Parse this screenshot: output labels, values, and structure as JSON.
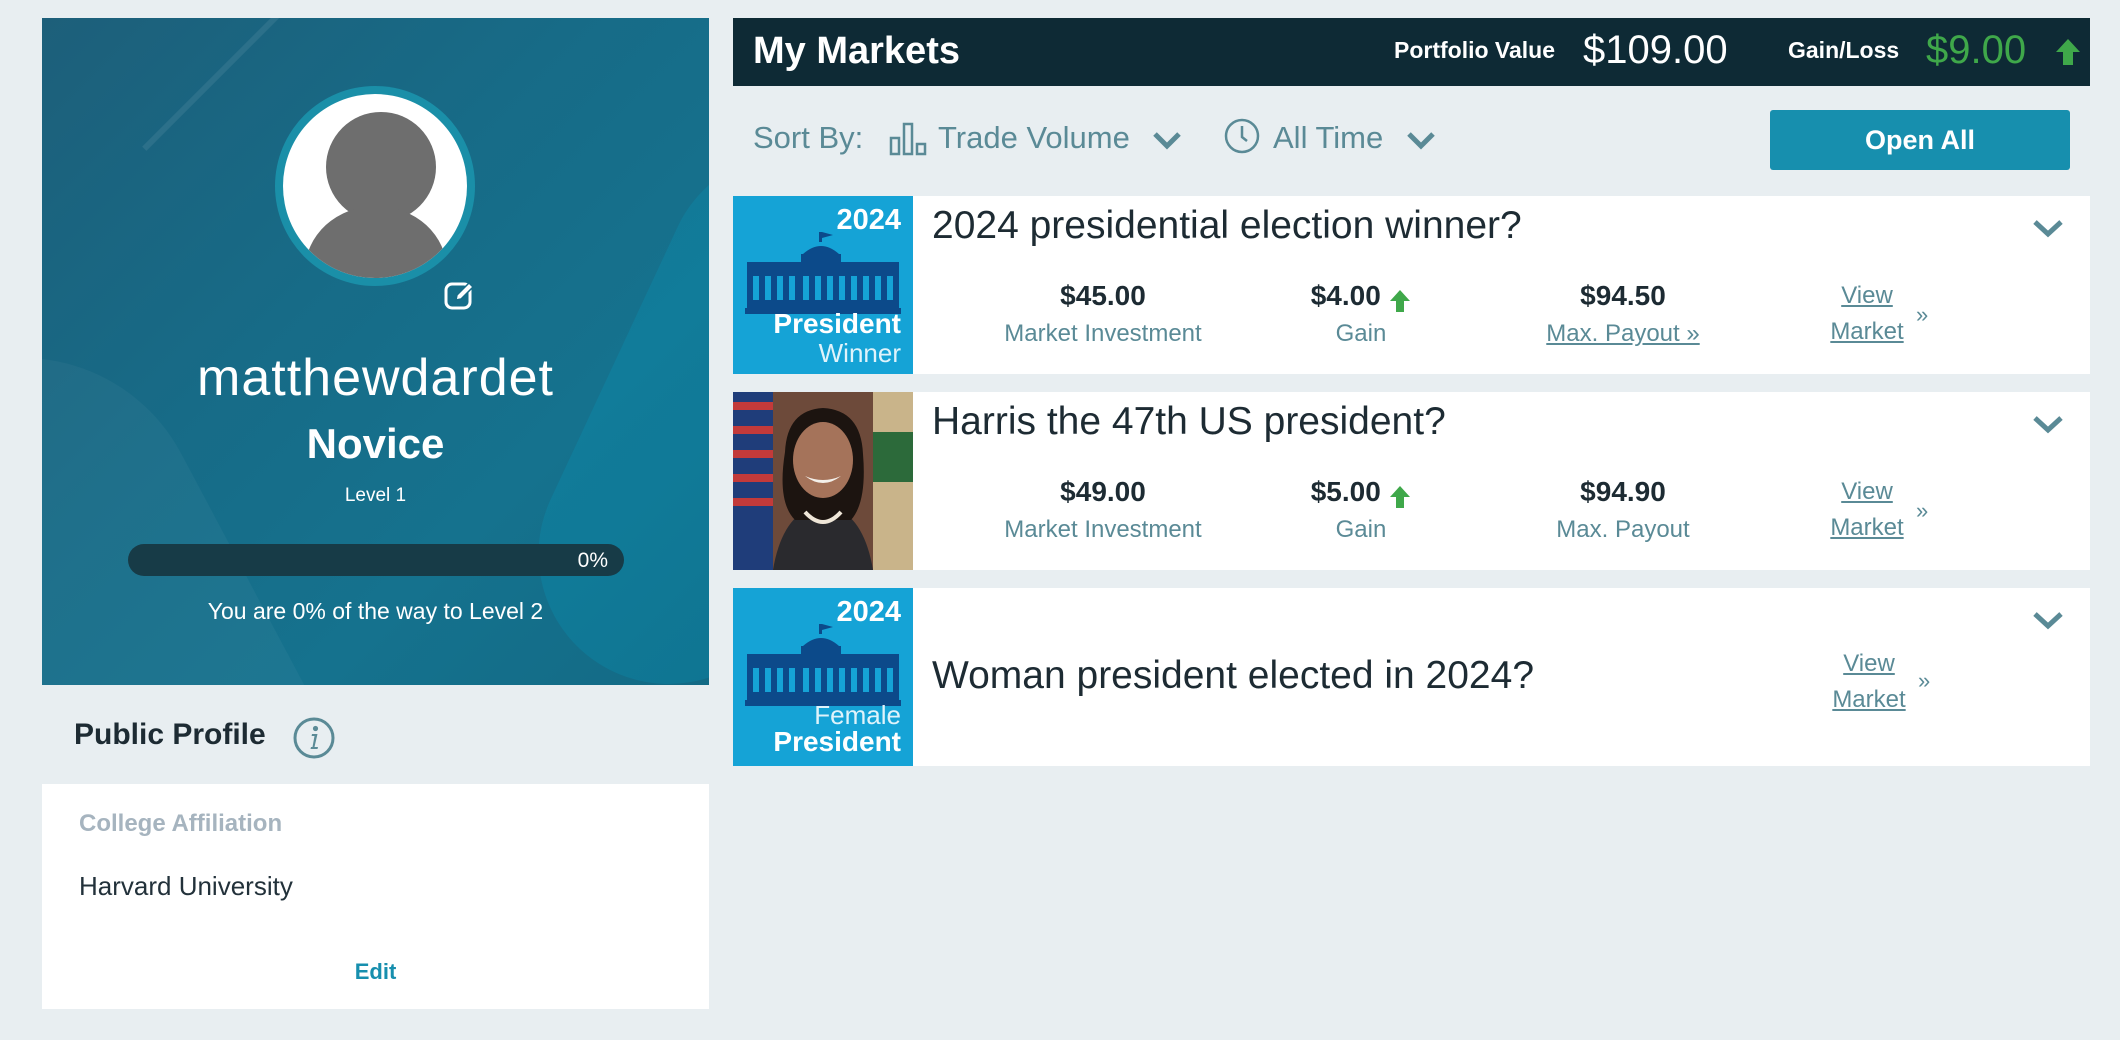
{
  "profile": {
    "username": "matthewdardet",
    "rank": "Novice",
    "level": "Level 1",
    "progress": 0,
    "progress_pct_label": "0%",
    "progress_text": "You are 0% of the way to Level 2"
  },
  "public_profile": {
    "title": "Public Profile",
    "college_label": "College Affiliation",
    "college_value": "Harvard University",
    "edit_label": "Edit"
  },
  "header": {
    "title": "My Markets",
    "portfolio_label": "Portfolio Value",
    "portfolio_value": "$109.00",
    "gainloss_label": "Gain/Loss",
    "gainloss_value": "$9.00"
  },
  "sortbar": {
    "label": "Sort By:",
    "sort_option": "Trade Volume",
    "time_option": "All Time",
    "open_all": "Open All"
  },
  "markets": [
    {
      "question": "2024 presidential election winner?",
      "thumb_year": "2024",
      "thumb_line1": "President",
      "thumb_line2": "Winner",
      "investment": "$45.00",
      "investment_label": "Market Investment",
      "gain": "$4.00",
      "gain_label": "Gain",
      "payout": "$94.50",
      "payout_label": "Max. Payout »",
      "view_line1": "View",
      "view_line2": "Market"
    },
    {
      "question": "Harris the 47th US president?",
      "investment": "$49.00",
      "investment_label": "Market Investment",
      "gain": "$5.00",
      "gain_label": "Gain",
      "payout": "$94.90",
      "payout_label": "Max. Payout",
      "view_line1": "View",
      "view_line2": "Market"
    },
    {
      "question": "Woman president elected in 2024?",
      "thumb_year": "2024",
      "thumb_line1": "Female",
      "thumb_line2": "President",
      "view_line1": "View",
      "view_line2": "Market"
    }
  ],
  "colors": {
    "accent": "#178fae",
    "header_bg": "#0e2a35",
    "gain_green": "#3fa84a"
  }
}
